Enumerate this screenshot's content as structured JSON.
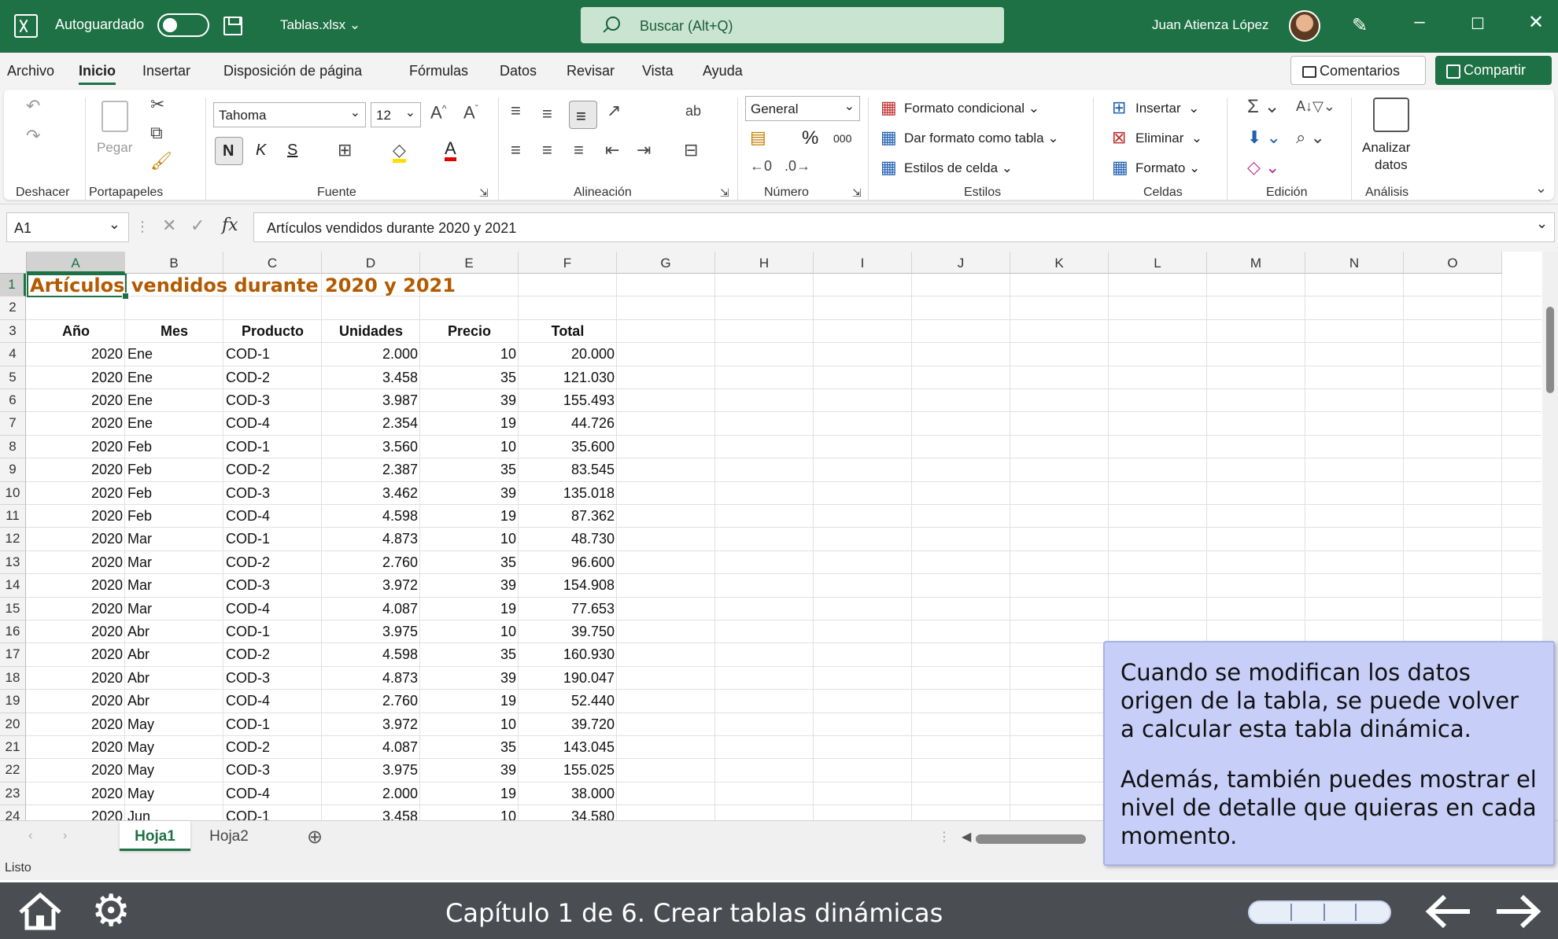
{
  "titlebar": {
    "autosave_label": "Autoguardado",
    "filename": "Tablas.xlsx",
    "search_placeholder": "Buscar (Alt+Q)",
    "user_name": "Juan Atienza López"
  },
  "menu": {
    "items": [
      "Archivo",
      "Inicio",
      "Insertar",
      "Disposición de página",
      "Fórmulas",
      "Datos",
      "Revisar",
      "Vista",
      "Ayuda"
    ],
    "active": "Inicio",
    "comments_label": "Comentarios",
    "share_label": "Compartir"
  },
  "ribbon": {
    "paste_label": "Pegar",
    "font_name": "Tahoma",
    "font_size": "12",
    "bold": "N",
    "italic": "K",
    "underline": "S",
    "number_format": "General",
    "percent": "%",
    "thousands": "000",
    "cond_format": "Formato condicional",
    "format_table": "Dar formato como tabla",
    "cell_styles": "Estilos de celda",
    "insert": "Insertar",
    "delete": "Eliminar",
    "format": "Formato",
    "analyze_1": "Analizar",
    "analyze_2": "datos",
    "groups": {
      "undo": "Deshacer",
      "clipboard": "Portapapeles",
      "font": "Fuente",
      "alignment": "Alineación",
      "number": "Número",
      "styles": "Estilos",
      "cells": "Celdas",
      "editing": "Edición",
      "analysis": "Análisis"
    }
  },
  "formula_bar": {
    "cell_ref": "A1",
    "fx": "fx",
    "content": "Artículos vendidos durante 2020 y 2021"
  },
  "sheet": {
    "columns": [
      "A",
      "B",
      "C",
      "D",
      "E",
      "F",
      "G",
      "H",
      "I",
      "J",
      "K",
      "L",
      "M",
      "N",
      "O"
    ],
    "row_numbers": [
      "1",
      "2",
      "3",
      "4",
      "5",
      "6",
      "7",
      "8",
      "9",
      "10",
      "11",
      "12",
      "13",
      "14",
      "15",
      "16",
      "17",
      "18",
      "19",
      "20",
      "21",
      "22",
      "23",
      "24"
    ],
    "title": "Artículos vendidos durante 2020 y 2021",
    "headers": [
      "Año",
      "Mes",
      "Producto",
      "Unidades",
      "Precio",
      "Total"
    ],
    "rows": [
      [
        "2020",
        "Ene",
        "COD-1",
        "2.000",
        "10",
        "20.000"
      ],
      [
        "2020",
        "Ene",
        "COD-2",
        "3.458",
        "35",
        "121.030"
      ],
      [
        "2020",
        "Ene",
        "COD-3",
        "3.987",
        "39",
        "155.493"
      ],
      [
        "2020",
        "Ene",
        "COD-4",
        "2.354",
        "19",
        "44.726"
      ],
      [
        "2020",
        "Feb",
        "COD-1",
        "3.560",
        "10",
        "35.600"
      ],
      [
        "2020",
        "Feb",
        "COD-2",
        "2.387",
        "35",
        "83.545"
      ],
      [
        "2020",
        "Feb",
        "COD-3",
        "3.462",
        "39",
        "135.018"
      ],
      [
        "2020",
        "Feb",
        "COD-4",
        "4.598",
        "19",
        "87.362"
      ],
      [
        "2020",
        "Mar",
        "COD-1",
        "4.873",
        "10",
        "48.730"
      ],
      [
        "2020",
        "Mar",
        "COD-2",
        "2.760",
        "35",
        "96.600"
      ],
      [
        "2020",
        "Mar",
        "COD-3",
        "3.972",
        "39",
        "154.908"
      ],
      [
        "2020",
        "Mar",
        "COD-4",
        "4.087",
        "19",
        "77.653"
      ],
      [
        "2020",
        "Abr",
        "COD-1",
        "3.975",
        "10",
        "39.750"
      ],
      [
        "2020",
        "Abr",
        "COD-2",
        "4.598",
        "35",
        "160.930"
      ],
      [
        "2020",
        "Abr",
        "COD-3",
        "4.873",
        "39",
        "190.047"
      ],
      [
        "2020",
        "Abr",
        "COD-4",
        "2.760",
        "19",
        "52.440"
      ],
      [
        "2020",
        "May",
        "COD-1",
        "3.972",
        "10",
        "39.720"
      ],
      [
        "2020",
        "May",
        "COD-2",
        "4.087",
        "35",
        "143.045"
      ],
      [
        "2020",
        "May",
        "COD-3",
        "3.975",
        "39",
        "155.025"
      ],
      [
        "2020",
        "May",
        "COD-4",
        "2.000",
        "19",
        "38.000"
      ],
      [
        "2020",
        "Jun",
        "COD-1",
        "3.458",
        "10",
        "34.580"
      ]
    ]
  },
  "sheet_tabs": [
    "Hoja1",
    "Hoja2"
  ],
  "status": {
    "text": "Listo"
  },
  "callout": {
    "p1": "Cuando se modifican los datos origen de la tabla, se puede volver a calcular esta tabla dinámica.",
    "p2": "Además, también puedes mostrar el nivel de detalle que quieras en cada momento."
  },
  "bottom_nav": {
    "chapter": "Capítulo 1 de 6. Crear tablas dinámicas"
  },
  "colors": {
    "excel_green": "#1e7145",
    "title_orange": "#b35a00",
    "callout_bg": "#c7cff8",
    "nav_bg": "#4a4d52"
  }
}
